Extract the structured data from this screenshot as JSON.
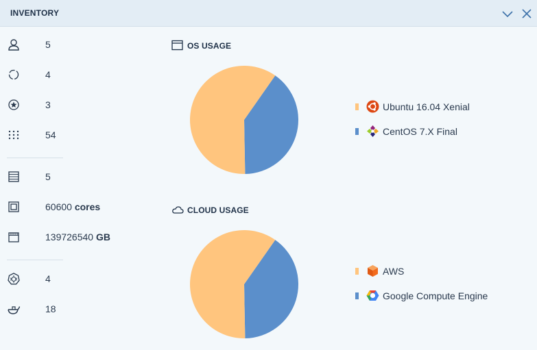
{
  "header": {
    "title": "INVENTORY"
  },
  "stats": [
    {
      "icon": "user-icon",
      "value": "5",
      "unit": ""
    },
    {
      "icon": "refresh-circle-icon",
      "value": "4",
      "unit": ""
    },
    {
      "icon": "star-circle-icon",
      "value": "3",
      "unit": ""
    },
    {
      "icon": "grid-dots-icon",
      "value": "54",
      "unit": ""
    },
    {
      "icon": "server-icon",
      "value": "5",
      "unit": ""
    },
    {
      "icon": "cpu-icon",
      "value": "60600",
      "unit": "cores"
    },
    {
      "icon": "memory-icon",
      "value": "139726540",
      "unit": "GB"
    },
    {
      "icon": "kubernetes-icon",
      "value": "4",
      "unit": ""
    },
    {
      "icon": "docker-icon",
      "value": "18",
      "unit": ""
    }
  ],
  "os_usage": {
    "title": "OS USAGE",
    "chart_data": {
      "type": "pie",
      "series": [
        {
          "name": "Ubuntu 16.04 Xenial",
          "value": 60,
          "color": "#ffc57e",
          "logo": "ubuntu-logo"
        },
        {
          "name": "CentOS 7.X Final",
          "value": 40,
          "color": "#5b8fcb",
          "logo": "centos-logo"
        }
      ]
    }
  },
  "cloud_usage": {
    "title": "CLOUD USAGE",
    "chart_data": {
      "type": "pie",
      "series": [
        {
          "name": "AWS",
          "value": 60,
          "color": "#ffc57e",
          "logo": "aws-logo"
        },
        {
          "name": "Google Compute Engine",
          "value": 40,
          "color": "#5b8fcb",
          "logo": "gce-logo"
        }
      ]
    }
  },
  "colors": {
    "accent_orange": "#ffc57e",
    "accent_blue": "#5b8fcb",
    "header_bg": "#e3edf5"
  }
}
